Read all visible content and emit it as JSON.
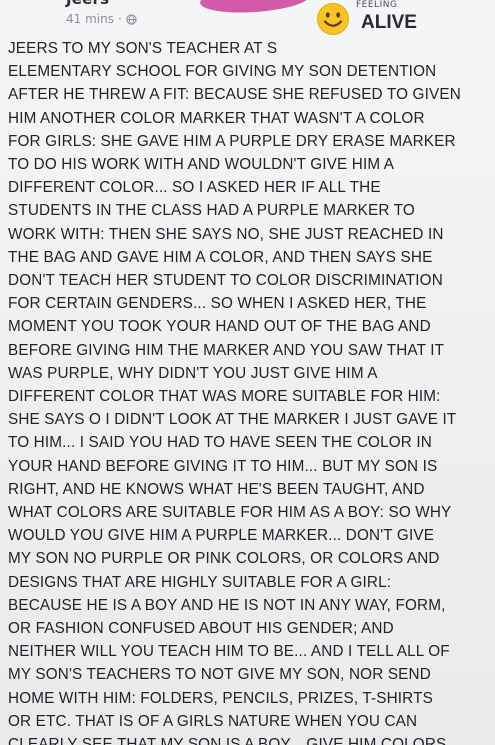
{
  "post": {
    "author": "Jeers",
    "timestamp": "41 mins",
    "separator": "·",
    "privacy_icon": "globe-icon",
    "feeling": {
      "label": "FEELING",
      "value": "ALIVE",
      "emoji_icon": "smiley-face-icon"
    },
    "body": "JEERS TO MY SON'S TEACHER AT S\nELEMENTARY SCHOOL FOR GIVING MY SON DETENTION\nAFTER HE THREW A FIT: BECAUSE SHE REFUSED TO GIVEN\nHIM ANOTHER COLOR MARKER THAT WASN'T A COLOR\nFOR GIRLS: SHE GAVE HIM A PURPLE DRY ERASE MARKER\nTO DO HIS WORK WITH AND WOULDN'T GIVE HIM A\nDIFFERENT COLOR... SO I ASKED HER IF ALL THE\nSTUDENTS IN THE CLASS HAD A PURPLE MARKER TO\nWORK WITH: THEN SHE SAYS NO, SHE JUST REACHED IN\nTHE BAG AND GAVE HIM A COLOR, AND THEN SAYS SHE\nDON'T TEACH HER STUDENT TO COLOR DISCRIMINATION\nFOR CERTAIN GENDERS... SO WHEN I ASKED HER, THE\nMOMENT YOU TOOK YOUR HAND OUT OF THE BAG AND\nBEFORE GIVING HIM THE MARKER AND YOU SAW THAT IT\nWAS PURPLE, WHY DIDN'T YOU JUST GIVE HIM A\nDIFFERENT COLOR THAT WAS MORE SUITABLE FOR HIM:\nSHE SAYS O I DIDN'T LOOK AT THE MARKER I JUST GAVE IT\nTO HIM... I SAID YOU HAD TO HAVE SEEN THE COLOR IN\nYOUR HAND BEFORE GIVING IT TO HIM... BUT MY SON IS\nRIGHT, AND HE KNOWS WHAT HE'S BEEN TAUGHT, AND\nWHAT COLORS ARE SUITABLE FOR HIM AS A BOY: SO WHY\nWOULD YOU GIVE HIM A PURPLE MARKER... DON'T GIVE\nMY SON NO PURPLE OR PINK COLORS, OR COLORS AND\nDESIGNS THAT ARE HIGHLY SUITABLE FOR A GIRL:\nBECAUSE HE IS A BOY AND HE IS NOT IN ANY WAY, FORM,\nOR FASHION CONFUSED ABOUT HIS GENDER; AND\nNEITHER WILL YOU TEACH HIM TO BE... AND I TELL ALL OF\nMY SON'S TEACHERS TO NOT GIVE MY SON, NOR SEND\nHOME WITH HIM: FOLDERS, PENCILS, PRIZES, T-SHIRTS\nOR ETC. THAT IS OF A GIRLS NATURE WHEN YOU CAN\nCLEARLY SEE THAT MY SON IS A BOY... GIVE HIM COLORS\nAND ITEMS THAT ARE SUITABLE FOR A BOY, AND NOT FOR"
  },
  "colors": {
    "background": "#f1f2f4",
    "text": "#222327",
    "meta_text": "#8c9097",
    "emoji_yellow": "#f7c325",
    "pink_accent": "#d25aa9"
  }
}
